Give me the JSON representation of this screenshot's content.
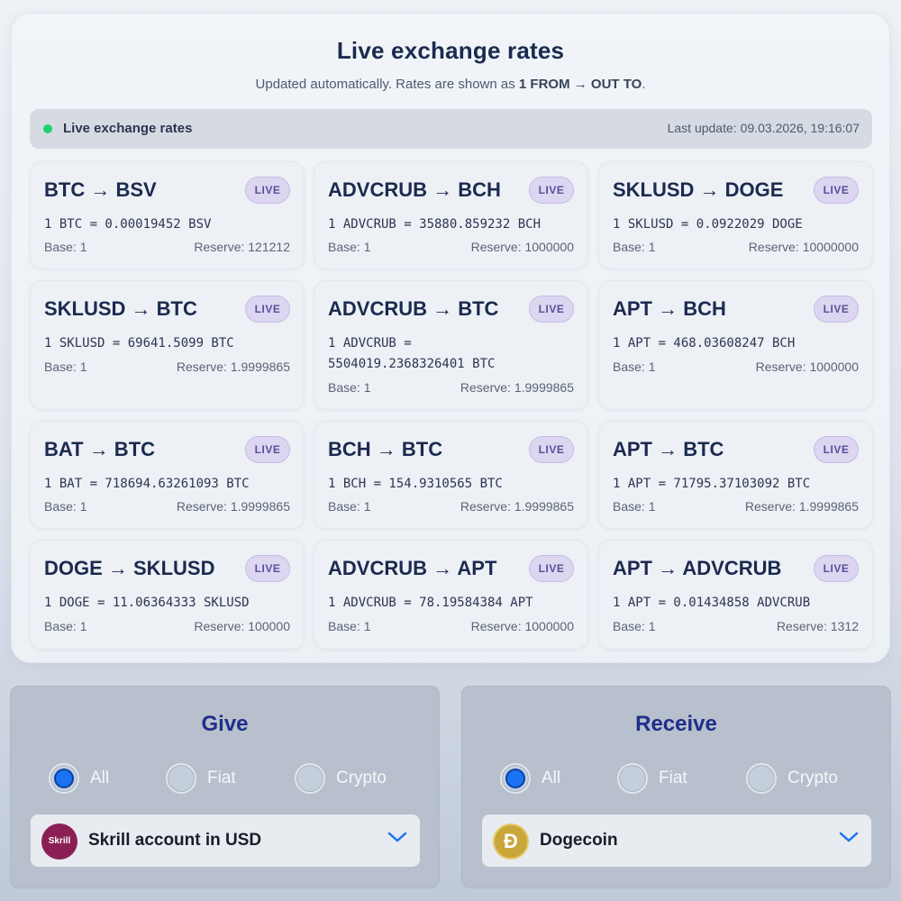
{
  "rates": {
    "title": "Live exchange rates",
    "subtitle_prefix": "Updated automatically. Rates are shown as ",
    "subtitle_bold": "1 FROM → OUT TO",
    "subtitle_suffix": ".",
    "status": {
      "label": "Live exchange rates",
      "last_update_label": "Last update:",
      "last_update_value": "09.03.2026, 19:16:07",
      "dot_color": "#1fd26e"
    },
    "badge_text": "LIVE",
    "cards": [
      {
        "title": "BTC → BSV",
        "rate": "1 BTC = 0.00019452 BSV",
        "base": "Base: 1",
        "reserve": "Reserve: 121212"
      },
      {
        "title": "ADVCRUB → BCH",
        "rate": "1 ADVCRUB = 35880.859232 BCH",
        "base": "Base: 1",
        "reserve": "Reserve: 1000000"
      },
      {
        "title": "SKLUSD → DOGE",
        "rate": "1 SKLUSD = 0.0922029 DOGE",
        "base": "Base: 1",
        "reserve": "Reserve: 10000000"
      },
      {
        "title": "SKLUSD → BTC",
        "rate": "1 SKLUSD = 69641.5099 BTC",
        "base": "Base: 1",
        "reserve": "Reserve: 1.9999865"
      },
      {
        "title": "ADVCRUB → BTC",
        "rate": "1 ADVCRUB = 5504019.2368326401 BTC",
        "base": "Base: 1",
        "reserve": "Reserve: 1.9999865"
      },
      {
        "title": "APT → BCH",
        "rate": "1 APT = 468.03608247 BCH",
        "base": "Base: 1",
        "reserve": "Reserve: 1000000"
      },
      {
        "title": "BAT → BTC",
        "rate": "1 BAT = 718694.63261093 BTC",
        "base": "Base: 1",
        "reserve": "Reserve: 1.9999865"
      },
      {
        "title": "BCH → BTC",
        "rate": "1 BCH = 154.9310565 BTC",
        "base": "Base: 1",
        "reserve": "Reserve: 1.9999865"
      },
      {
        "title": "APT → BTC",
        "rate": "1 APT = 71795.37103092 BTC",
        "base": "Base: 1",
        "reserve": "Reserve: 1.9999865"
      },
      {
        "title": "DOGE → SKLUSD",
        "rate": "1 DOGE = 11.06364333 SKLUSD",
        "base": "Base: 1",
        "reserve": "Reserve: 100000"
      },
      {
        "title": "ADVCRUB → APT",
        "rate": "1 ADVCRUB = 78.19584384 APT",
        "base": "Base: 1",
        "reserve": "Reserve: 1000000"
      },
      {
        "title": "APT → ADVCRUB",
        "rate": "1 APT = 0.01434858 ADVCRUB",
        "base": "Base: 1",
        "reserve": "Reserve: 1312"
      }
    ]
  },
  "give": {
    "title": "Give",
    "options": [
      "All",
      "Fiat",
      "Crypto"
    ],
    "selected_option": "All",
    "select_value": "Skrill account in USD",
    "logo_icon": "skrill-logo",
    "logo_text": "Skrill"
  },
  "receive": {
    "title": "Receive",
    "options": [
      "All",
      "Fiat",
      "Crypto"
    ],
    "selected_option": "All",
    "select_value": "Dogecoin",
    "logo_icon": "dogecoin-logo",
    "logo_text": "Ð"
  },
  "colors": {
    "accent_blue": "#1a73f0",
    "heading_navy": "#1f2f8a",
    "live_badge": "#dcd6f1"
  }
}
